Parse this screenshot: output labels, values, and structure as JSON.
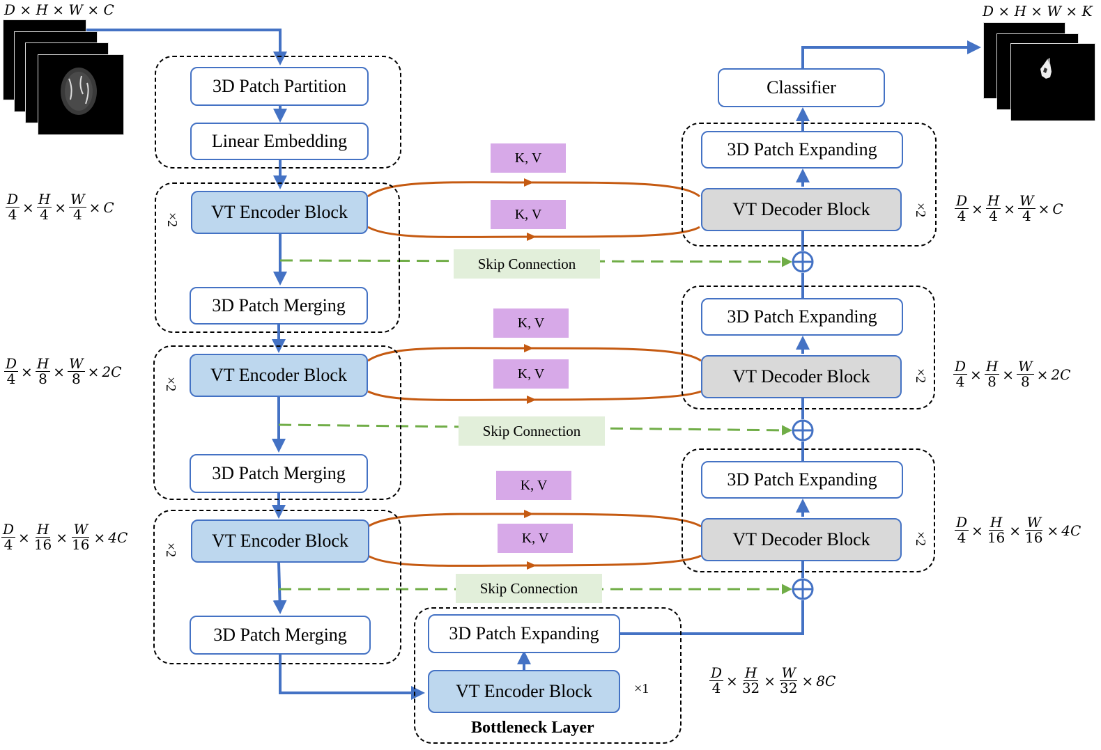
{
  "input": {
    "label": "D × H × W × C",
    "slices": 4
  },
  "output": {
    "label": "D × H × W × K",
    "slices": 3
  },
  "encoder": {
    "patch_partition": "3D Patch Partition",
    "linear_embedding": "Linear Embedding",
    "stages": [
      {
        "block": "VT Encoder Block",
        "merge": "3D Patch Merging",
        "repeat": "×2",
        "dim": {
          "d": [
            "D",
            "4"
          ],
          "h": [
            "H",
            "4"
          ],
          "w": [
            "W",
            "4"
          ],
          "c": "C"
        }
      },
      {
        "block": "VT Encoder Block",
        "merge": "3D Patch Merging",
        "repeat": "×2",
        "dim": {
          "d": [
            "D",
            "4"
          ],
          "h": [
            "H",
            "8"
          ],
          "w": [
            "W",
            "8"
          ],
          "c": "2C"
        }
      },
      {
        "block": "VT Encoder Block",
        "merge": "3D Patch Merging",
        "repeat": "×2",
        "dim": {
          "d": [
            "D",
            "4"
          ],
          "h": [
            "H",
            "16"
          ],
          "w": [
            "W",
            "16"
          ],
          "c": "4C"
        }
      }
    ]
  },
  "bottleneck": {
    "expand": "3D Patch Expanding",
    "block": "VT Encoder Block",
    "repeat": "×1",
    "title": "Bottleneck Layer",
    "dim": {
      "d": [
        "D",
        "4"
      ],
      "h": [
        "H",
        "32"
      ],
      "w": [
        "W",
        "32"
      ],
      "c": "8C"
    }
  },
  "decoder": {
    "classifier": "Classifier",
    "stages": [
      {
        "block": "VT Decoder Block",
        "expand": "3D Patch Expanding",
        "repeat": "×2",
        "dim": {
          "d": [
            "D",
            "4"
          ],
          "h": [
            "H",
            "4"
          ],
          "w": [
            "W",
            "4"
          ],
          "c": "C"
        }
      },
      {
        "block": "VT Decoder Block",
        "expand": "3D Patch Expanding",
        "repeat": "×2",
        "dim": {
          "d": [
            "D",
            "4"
          ],
          "h": [
            "H",
            "8"
          ],
          "w": [
            "W",
            "8"
          ],
          "c": "2C"
        }
      },
      {
        "block": "VT Decoder Block",
        "expand": "3D Patch Expanding",
        "repeat": "×2",
        "dim": {
          "d": [
            "D",
            "4"
          ],
          "h": [
            "H",
            "16"
          ],
          "w": [
            "W",
            "16"
          ],
          "c": "4C"
        }
      }
    ]
  },
  "connections": {
    "kv_label": "K, V",
    "skip_label": "Skip Connection"
  },
  "colors": {
    "flow": "#4472c4",
    "kv_arrow": "#c55a11",
    "skip": "#70ad47",
    "encoder_fill": "#bdd7ee",
    "decoder_fill": "#d9d9d9",
    "kv_fill": "#d7a9e8",
    "skip_fill": "#e2efda"
  }
}
